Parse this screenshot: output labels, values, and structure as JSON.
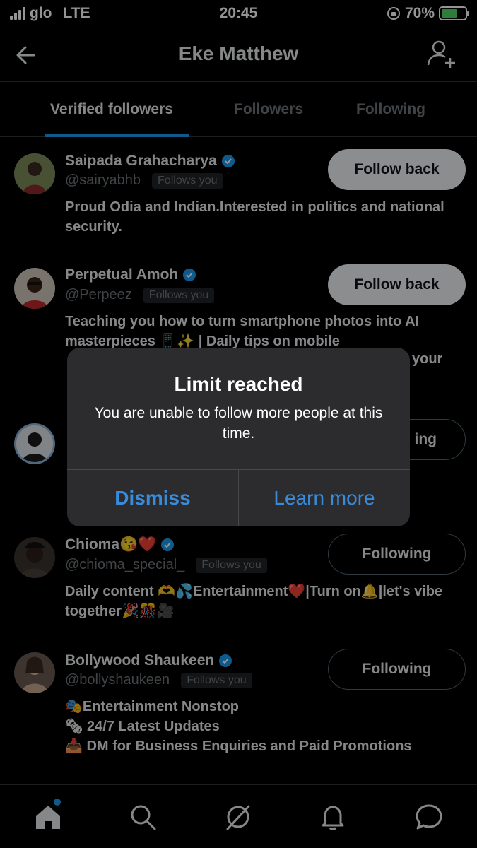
{
  "status_bar": {
    "carrier": "glo",
    "network": "LTE",
    "time": "20:45",
    "battery": "70%",
    "battery_level": 0.7
  },
  "header": {
    "title": "Eke Matthew"
  },
  "tabs": [
    {
      "label": "Verified followers",
      "active": true
    },
    {
      "label": "Followers",
      "active": false
    },
    {
      "label": "Following",
      "active": false
    }
  ],
  "users": [
    {
      "name": "Saipada Grahacharya",
      "handle": "@sairyabhb",
      "follows_you": "Follows you",
      "bio": "Proud Odia and Indian.Interested in politics and national security.",
      "button": "Follow back"
    },
    {
      "name": "Perpetual Amoh",
      "handle": "@Perpeez",
      "follows_you": "Follows you",
      "bio": "Teaching you how to turn smartphone photos into AI masterpieces 📱✨ | Daily tips on mobile",
      "bio_partial": "your",
      "button": "Follow back"
    },
    {
      "button_partial": "ing"
    },
    {
      "name": "Chioma😘❤️",
      "handle": "@chioma_special_",
      "follows_you": "Follows you",
      "bio": "Daily content 🫶💦Entertainment❤️|Turn on🔔|let's vibe together🎉🎊🎥",
      "button": "Following"
    },
    {
      "name": "Bollywood Shaukeen",
      "handle": "@bollyshaukeen",
      "follows_you": "Follows you",
      "bio_lines": [
        "🎭Entertainment Nonstop",
        "🗞 24/7 Latest Updates",
        "📥 DM for Business Enquiries and Paid Promotions"
      ],
      "button": "Following"
    }
  ],
  "alert": {
    "title": "Limit reached",
    "message": "You are unable to follow more people at this time.",
    "dismiss": "Dismiss",
    "learn_more": "Learn more"
  },
  "colors": {
    "accent": "#1d9bf0",
    "alert_button": "#3a8bd9",
    "background": "#000000"
  }
}
